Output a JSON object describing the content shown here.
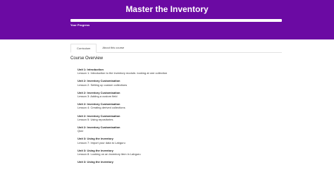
{
  "hero": {
    "title": "Master the Inventory",
    "progress_label": "Your Progress",
    "progress_fraction": 0.0
  },
  "tabs": [
    {
      "label": "Curriculum",
      "active": true
    },
    {
      "label": "About this course",
      "active": false
    }
  ],
  "overview_title": "Course Overview",
  "lessons": [
    {
      "unit": "Unit 1: Introduction",
      "name": "Lesson 1: Introduction to the inventory module- looking at one collection"
    },
    {
      "unit": "Unit 2: Inventory Customisation",
      "name": "Lesson 2: Setting up custom collections"
    },
    {
      "unit": "Unit 2: Inventory Customisation",
      "name": "Lesson 3: Adding a custom field"
    },
    {
      "unit": "Unit 2: Inventory Customisation",
      "name": "Lesson 4: Creating derived collections"
    },
    {
      "unit": "Unit 2: Inventory Customisation",
      "name": "Lesson 5: Using repositories"
    },
    {
      "unit": "Unit 2: Inventory Customisation",
      "name": "Quiz"
    },
    {
      "unit": "Unit 3: Using the inventory",
      "name": "Lesson 7: Import your data to Labguru"
    },
    {
      "unit": "Unit 3: Using the inventory",
      "name": "Lesson 8: Looking on an inventory item in Labguru"
    },
    {
      "unit": "Unit 3: Using the inventory",
      "name": ""
    }
  ]
}
